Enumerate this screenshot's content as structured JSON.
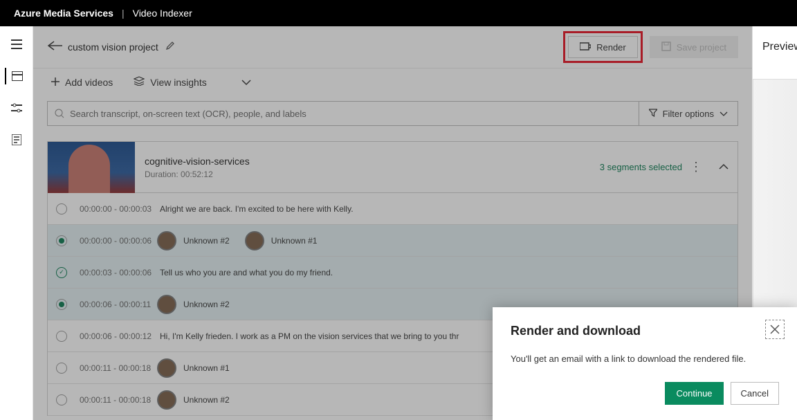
{
  "titlebar": {
    "product": "Azure Media Services",
    "separator": "|",
    "feature": "Video Indexer"
  },
  "project": {
    "name": "custom vision project"
  },
  "actions": {
    "render": "Render",
    "save": "Save project"
  },
  "toolbar": {
    "add_videos": "Add videos",
    "view_insights": "View insights"
  },
  "search": {
    "placeholder": "Search transcript, on-screen text (OCR), people, and labels",
    "filter": "Filter options"
  },
  "clip": {
    "title": "cognitive-vision-services",
    "duration_label": "Duration: 00:52:12",
    "segments_selected": "3 segments selected"
  },
  "segments": [
    {
      "selected": false,
      "time": "00:00:00 - 00:00:03",
      "text": "Alright we are back. I'm excited to be here with Kelly."
    },
    {
      "selected": true,
      "time": "00:00:00 - 00:00:06",
      "speakers": [
        "Unknown #2",
        "Unknown #1"
      ]
    },
    {
      "selected": "check",
      "time": "00:00:03 - 00:00:06",
      "text": "Tell us who you are and what you do my friend."
    },
    {
      "selected": true,
      "time": "00:00:06 - 00:00:11",
      "speakers": [
        "Unknown #2"
      ]
    },
    {
      "selected": false,
      "time": "00:00:06 - 00:00:12",
      "text": "Hi, I'm Kelly frieden. I work as a PM on the vision services that we bring to you thr"
    },
    {
      "selected": false,
      "time": "00:00:11 - 00:00:18",
      "speakers": [
        "Unknown #1"
      ]
    },
    {
      "selected": false,
      "time": "00:00:11 - 00:00:18",
      "speakers": [
        "Unknown #2"
      ]
    }
  ],
  "preview": {
    "title": "Preview"
  },
  "dialog": {
    "title": "Render and download",
    "body": "You'll get an email with a link to download the rendered file.",
    "continue": "Continue",
    "cancel": "Cancel"
  }
}
